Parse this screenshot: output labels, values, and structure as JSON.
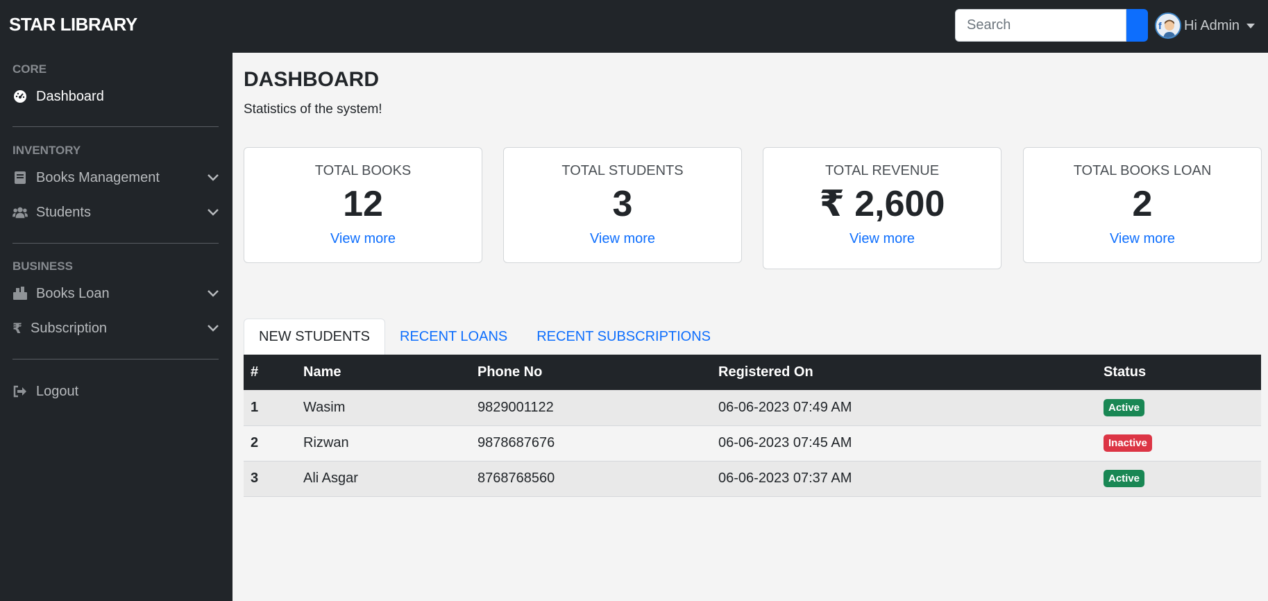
{
  "app": {
    "brand": "STAR LIBRARY"
  },
  "header": {
    "search_placeholder": "Search",
    "user_greeting": "Hi Admin"
  },
  "sidebar": {
    "sections": [
      {
        "heading": "CORE"
      },
      {
        "heading": "INVENTORY"
      },
      {
        "heading": "BUSINESS"
      }
    ],
    "items": [
      {
        "label": "Dashboard",
        "icon": "dashboard-icon"
      },
      {
        "label": "Books Management",
        "icon": "book-icon"
      },
      {
        "label": "Students",
        "icon": "users-icon"
      },
      {
        "label": "Books Loan",
        "icon": "book-loan-icon"
      },
      {
        "label": "Subscription",
        "icon": "rupee-icon"
      },
      {
        "label": "Logout",
        "icon": "logout-icon"
      }
    ]
  },
  "main": {
    "title": "DASHBOARD",
    "subtitle": "Statistics of the system!",
    "cards": [
      {
        "title": "TOTAL BOOKS",
        "value": "12",
        "link": "View more"
      },
      {
        "title": "TOTAL STUDENTS",
        "value": "3",
        "link": "View more"
      },
      {
        "title": "TOTAL REVENUE",
        "value": "₹ 2,600",
        "link": "View more"
      },
      {
        "title": "TOTAL BOOKS LOAN",
        "value": "2",
        "link": "View more"
      }
    ],
    "tabs": [
      {
        "label": "NEW STUDENTS"
      },
      {
        "label": "RECENT LOANS"
      },
      {
        "label": "RECENT SUBSCRIPTIONS"
      }
    ],
    "table": {
      "headers": [
        "#",
        "Name",
        "Phone No",
        "Registered On",
        "Status"
      ],
      "rows": [
        {
          "num": "1",
          "name": "Wasim",
          "phone": "9829001122",
          "registered": "06-06-2023 07:49 AM",
          "status": "Active"
        },
        {
          "num": "2",
          "name": "Rizwan",
          "phone": "9878687676",
          "registered": "06-06-2023 07:45 AM",
          "status": "Inactive"
        },
        {
          "num": "3",
          "name": "Ali Asgar",
          "phone": "8768768560",
          "registered": "06-06-2023 07:37 AM",
          "status": "Active"
        }
      ]
    }
  },
  "colors": {
    "sidebar_bg": "#212529",
    "accent": "#0d6efd",
    "active_badge": "#198754",
    "inactive_badge": "#dc3545"
  }
}
